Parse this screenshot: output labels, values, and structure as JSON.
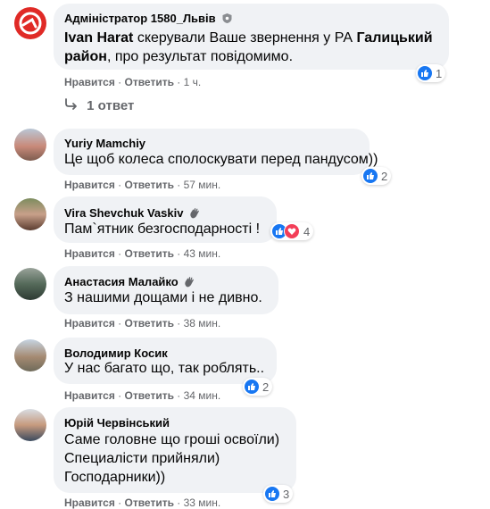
{
  "actions": {
    "like": "Нравится",
    "reply": "Ответить",
    "sep": " · "
  },
  "comments": [
    {
      "author": "Адміністратор 1580_Львів",
      "text_parts": [
        "Ivan Harat",
        " скерували Ваше звернення у РА ",
        "Галицький район",
        ", про результат повідомимо."
      ],
      "time": "1 ч.",
      "reactions": "1"
    },
    {
      "author": "Yuriy Mamchiy",
      "text": "Це щоб колеса сполоскувати перед пандусом))",
      "time": "57 мин.",
      "reactions": "2"
    },
    {
      "author": "Vira Shevchuk Vaskiv",
      "text": "Пам`ятник безгосподарності !",
      "time": "43 мин.",
      "reactions": "4"
    },
    {
      "author": "Анастасия Малайко",
      "text": "З нашими дощами і не дивно.",
      "time": "38 мин."
    },
    {
      "author": "Володимир Косик",
      "text": "У нас багато що, так роблять..",
      "time": "34 мин.",
      "reactions": "2"
    },
    {
      "author": "Юрій Червінський",
      "lines": [
        "Саме головне що гроші освоїли)",
        "Специалісти прийняли)",
        "Господарники))"
      ],
      "time": "33 мин.",
      "reactions": "3"
    }
  ],
  "replies_toggle": "1 ответ",
  "colors": {
    "bubble": "#f0f2f5",
    "like_blue": "#1877f2",
    "love_red": "#f33e58",
    "meta_gray": "#65676b"
  }
}
